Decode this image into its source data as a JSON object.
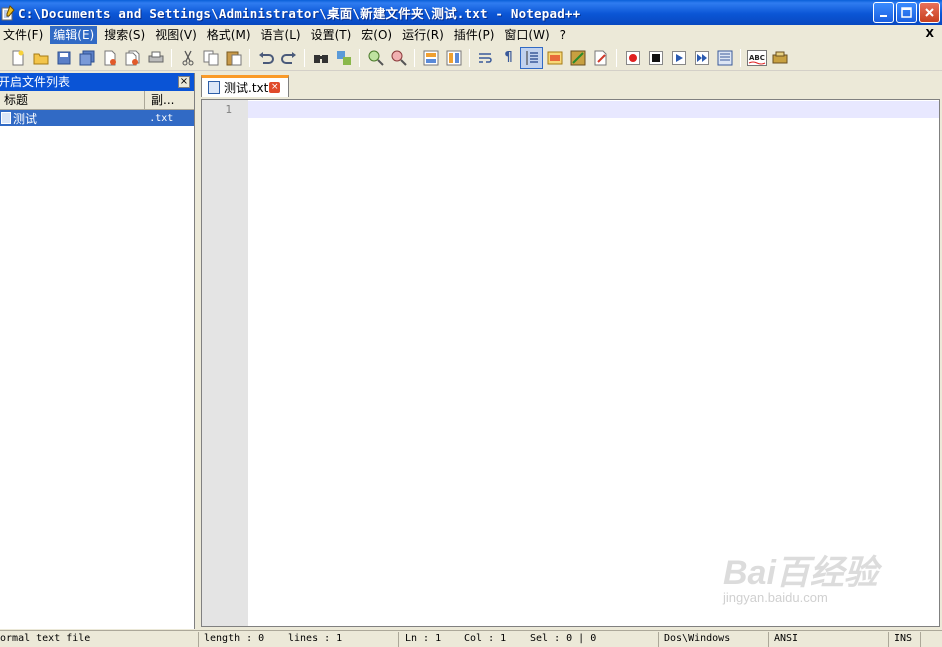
{
  "window": {
    "title": "C:\\Documents and Settings\\Administrator\\桌面\\新建文件夹\\测试.txt - Notepad++",
    "minimize_label": "_",
    "maximize_label": "□",
    "close_label": "X"
  },
  "menu": {
    "items": [
      "文件(F)",
      "编辑(E)",
      "搜索(S)",
      "视图(V)",
      "格式(M)",
      "语言(L)",
      "设置(T)",
      "宏(O)",
      "运行(R)",
      "插件(P)",
      "窗口(W)",
      "?"
    ],
    "close_label": "X"
  },
  "toolbar": {
    "icons": [
      "new-icon",
      "open-icon",
      "save-icon",
      "save-all-icon",
      "close-icon",
      "close-all-icon",
      "print-icon",
      "cut-icon",
      "copy-icon",
      "paste-icon",
      "undo-icon",
      "redo-icon",
      "find-icon",
      "replace-icon",
      "zoom-in-icon",
      "zoom-out-icon",
      "sync-vertical-icon",
      "sync-horizontal-icon",
      "word-wrap-icon",
      "show-all-chars-icon",
      "indent-guide-icon",
      "user-language-icon",
      "doc-map-icon",
      "function-list-icon",
      "record-macro-icon",
      "stop-macro-icon",
      "play-macro-icon",
      "run-macro-multiple-icon",
      "save-macro-icon",
      "spell-check-icon",
      "plugin-icon"
    ]
  },
  "left_panel": {
    "title": "开启文件列表",
    "close_label": "×",
    "columns": [
      "标题",
      "副..."
    ],
    "rows": [
      {
        "name": "测试",
        "ext": ".txt"
      }
    ]
  },
  "editor": {
    "tab_label": "测试.txt",
    "tab_close_label": "×",
    "line_numbers": [
      "1"
    ]
  },
  "watermark": {
    "logo": "Bai百经验",
    "url": "jingyan.baidu.com"
  },
  "statusbar": {
    "file_type": "Normal text file",
    "length": "length : 0",
    "lines": "lines : 1",
    "ln": "Ln : 1",
    "col": "Col : 1",
    "sel": "Sel : 0 | 0",
    "eol": "Dos\\Windows",
    "encoding": "ANSI",
    "mode": "INS"
  }
}
